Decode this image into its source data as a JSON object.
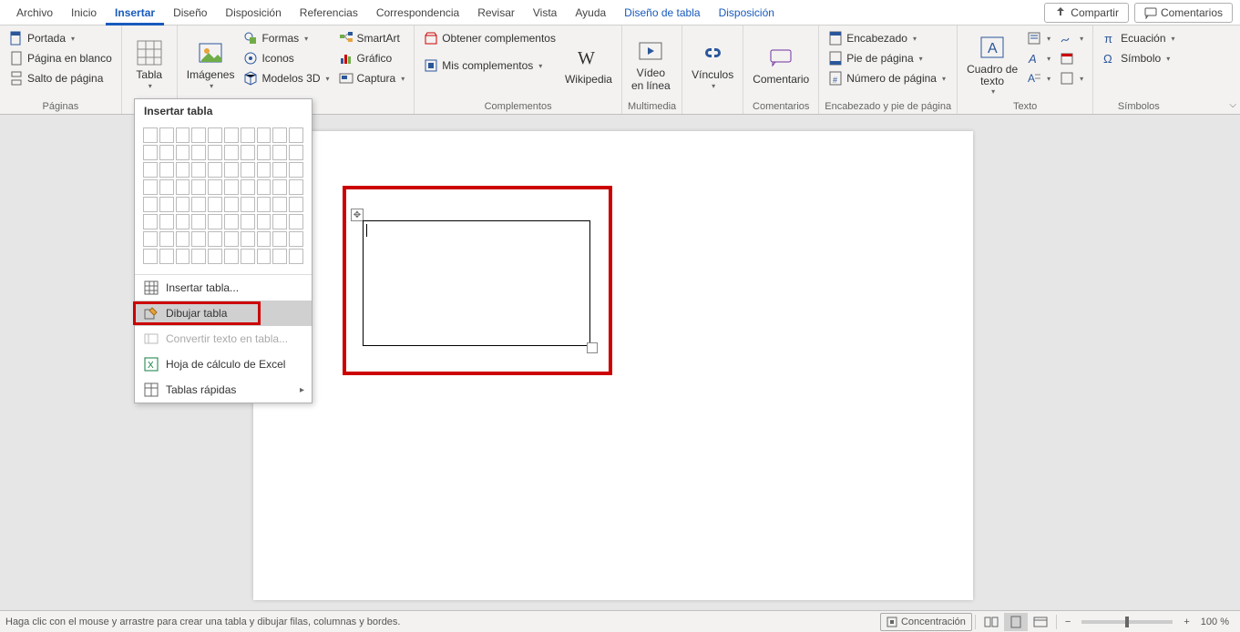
{
  "tabs": {
    "archivo": "Archivo",
    "inicio": "Inicio",
    "insertar": "Insertar",
    "diseno": "Diseño",
    "disposicion": "Disposición",
    "referencias": "Referencias",
    "correspondencia": "Correspondencia",
    "revisar": "Revisar",
    "vista": "Vista",
    "ayuda": "Ayuda",
    "diseno_tabla": "Diseño de tabla",
    "disposicion_tabla": "Disposición",
    "compartir": "Compartir",
    "comentarios": "Comentarios"
  },
  "ribbon": {
    "paginas": {
      "label": "Páginas",
      "portada": "Portada",
      "pagina_blanco": "Página en blanco",
      "salto_pagina": "Salto de página"
    },
    "tablas": {
      "tabla": "Tabla"
    },
    "ilustraciones": {
      "imagenes": "Imágenes",
      "formas": "Formas",
      "iconos": "Iconos",
      "modelos3d": "Modelos 3D",
      "smartart": "SmartArt",
      "grafico": "Gráfico",
      "captura": "Captura"
    },
    "complementos": {
      "label": "Complementos",
      "obtener": "Obtener complementos",
      "mis": "Mis complementos",
      "wikipedia": "Wikipedia"
    },
    "multimedia": {
      "label": "Multimedia",
      "video": "Vídeo\nen línea"
    },
    "vinculos": {
      "label": "",
      "vinculos": "Vínculos"
    },
    "comentarios": {
      "label": "Comentarios",
      "comentario": "Comentario"
    },
    "encabezado_pie": {
      "label": "Encabezado y pie de página",
      "encabezado": "Encabezado",
      "pie": "Pie de página",
      "numero": "Número de página"
    },
    "texto": {
      "label": "Texto",
      "cuadro": "Cuadro de\ntexto"
    },
    "simbolos": {
      "label": "Símbolos",
      "ecuacion": "Ecuación",
      "simbolo": "Símbolo"
    }
  },
  "dropdown": {
    "title": "Insertar tabla",
    "insertar_tabla": "Insertar tabla...",
    "dibujar_tabla": "Dibujar tabla",
    "convertir": "Convertir texto en tabla...",
    "hoja_excel": "Hoja de cálculo de Excel",
    "tablas_rapidas": "Tablas rápidas"
  },
  "statusbar": {
    "hint": "Haga clic con el mouse y arrastre para crear una tabla y dibujar filas, columnas y bordes.",
    "concentracion": "Concentración",
    "zoom": "100 %"
  }
}
